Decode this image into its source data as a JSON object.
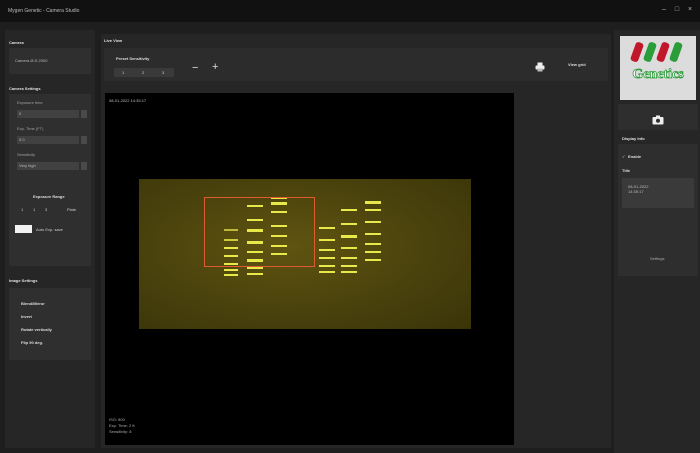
{
  "window": {
    "title": "Mygen Genetic - Camera Studio",
    "controls": [
      "–",
      "□",
      "×"
    ]
  },
  "camera": {
    "section_title": "Camera",
    "model": "Camera Ø-S 2000"
  },
  "camera_settings": {
    "section_title": "Camera Settings",
    "exposure_label": "Exposure time",
    "exposure_value": "0",
    "exp_time_label": "Exp. Time (FT)",
    "exp_time_value": "0.0",
    "sensitivity_label": "Sensitivity",
    "sensitivity_value": "Very high",
    "exposure_range_label": "Exposure Range",
    "range_start": "1",
    "range_end": "3",
    "range_step": "1",
    "range_units": "Plate",
    "auto_exposure_label": "Auto Exp. save"
  },
  "image_settings": {
    "section_title": "Image Settings",
    "items": [
      "Blend/Mirror",
      "Invert",
      "Rotate vertically",
      "Flip 90 deg."
    ]
  },
  "live_view": {
    "section_title": "Live View",
    "sensitivity_label": "Preset Sensitivity",
    "presets": [
      "1",
      "2",
      "3"
    ],
    "zoom_out": "−",
    "zoom_in": "+",
    "print_icon": "printer-icon",
    "view_grid_label": "View grid",
    "timestamp": "08-01-2022 14:35:17",
    "footer_lines": [
      "ISO: 800",
      "Exp. Time: 2 ft",
      "Sensitivity: 8"
    ]
  },
  "right_panel": {
    "logo_text": "Genetics",
    "camera_icon": "camera-icon",
    "display_info_label": "Display Info",
    "enable_label": "Enable",
    "check_mark": "✓",
    "title_label": "Title",
    "info_text": "08-01-2022 14:35:17",
    "settings_label": "Settings"
  },
  "colors": {
    "accent": "#e05a30",
    "band": "#e8e84a",
    "panel": "#2f2f2f",
    "background": "#1e1e1e"
  }
}
